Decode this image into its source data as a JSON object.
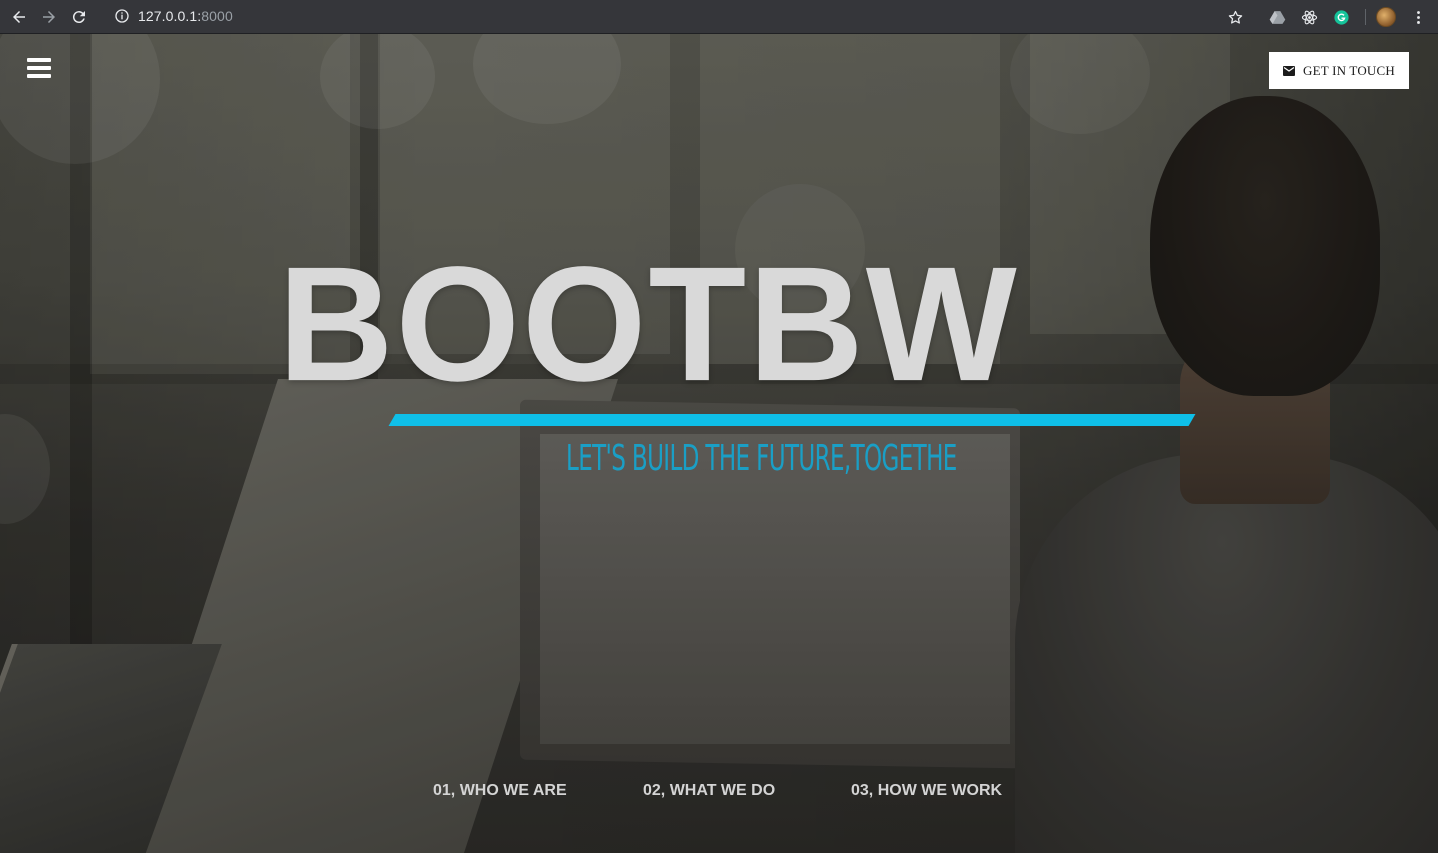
{
  "browser": {
    "url_host": "127.0.0.1:",
    "url_port": "8000",
    "icons": {
      "back": "arrow-left-icon",
      "forward": "arrow-right-icon",
      "reload": "reload-icon",
      "site_info": "info-icon",
      "bookmark": "star-icon",
      "extensions": [
        "google-drive-icon",
        "react-devtools-icon",
        "grammarly-icon"
      ],
      "profile": "avatar",
      "menu": "kebab-menu-icon"
    }
  },
  "header": {
    "menu_icon": "hamburger-icon",
    "touch_button": {
      "label": "GET IN TOUCH",
      "icon": "mail-icon"
    }
  },
  "hero": {
    "title": "BOOTBW",
    "tagline": "LET'S BUILD THE FUTURE,TOGETHE",
    "accent_color": "#0fbfe8",
    "tagline_color": "#1a9fc6"
  },
  "bottom_nav": [
    {
      "label": "01, WHO WE ARE"
    },
    {
      "label": "02, WHAT WE DO"
    },
    {
      "label": "03, HOW WE WORK"
    }
  ]
}
